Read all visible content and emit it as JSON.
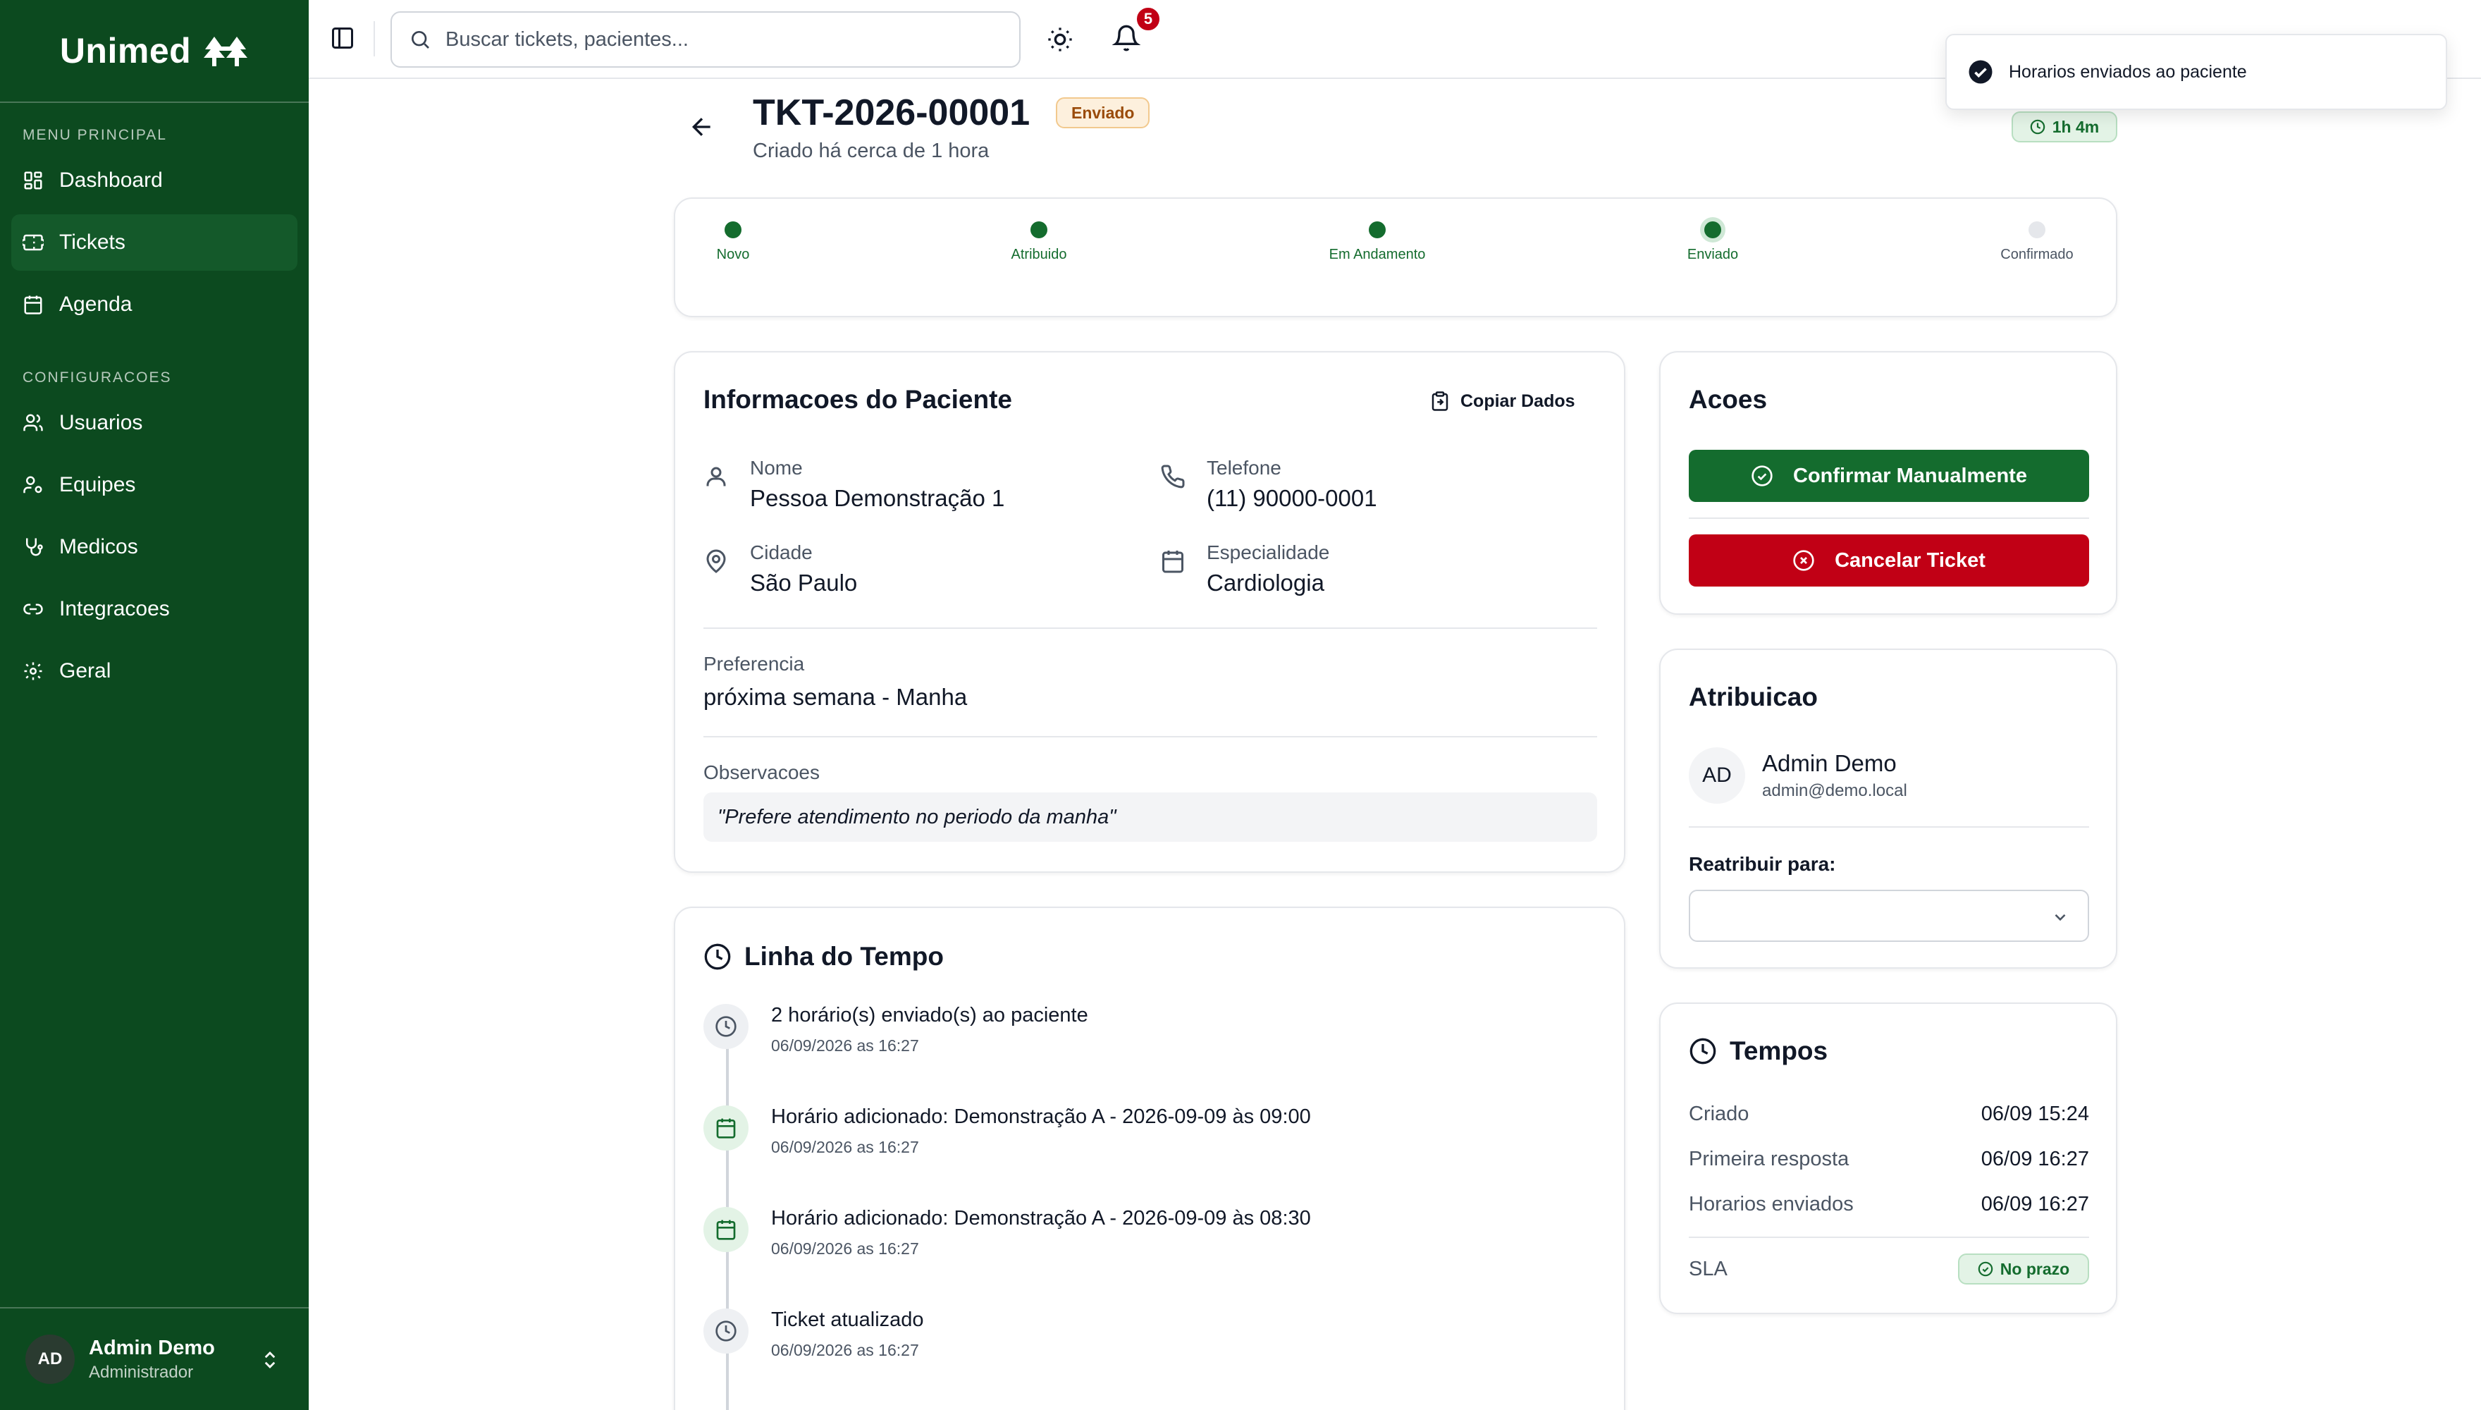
{
  "brand": {
    "name": "Unimed",
    "color": "#0c4a1f",
    "accent": "#146c2e",
    "danger": "#c10015"
  },
  "sidebar": {
    "main_label": "MENU PRINCIPAL",
    "main_items": [
      {
        "label": "Dashboard",
        "icon": "grid-icon"
      },
      {
        "label": "Tickets",
        "icon": "ticket-icon",
        "active": true
      },
      {
        "label": "Agenda",
        "icon": "calendar-icon"
      }
    ],
    "config_label": "CONFIGURACOES",
    "config_items": [
      {
        "label": "Usuarios",
        "icon": "users-icon"
      },
      {
        "label": "Equipes",
        "icon": "user-cog-icon"
      },
      {
        "label": "Medicos",
        "icon": "stethoscope-icon"
      },
      {
        "label": "Integracoes",
        "icon": "link-icon"
      },
      {
        "label": "Geral",
        "icon": "gear-icon"
      }
    ],
    "user": {
      "initials": "AD",
      "name": "Admin Demo",
      "role": "Administrador"
    }
  },
  "topbar": {
    "search_placeholder": "Buscar tickets, pacientes...",
    "notification_count": "5"
  },
  "toast": {
    "message": "Horarios enviados ao paciente"
  },
  "ticket": {
    "id": "TKT-2026-00001",
    "status": "Enviado",
    "created": "Criado há cerca de 1 hora",
    "elapsed": "1h 4m"
  },
  "progress": {
    "steps": [
      {
        "label": "Novo",
        "state": "done"
      },
      {
        "label": "Atribuido",
        "state": "done"
      },
      {
        "label": "Em Andamento",
        "state": "done"
      },
      {
        "label": "Enviado",
        "state": "current"
      },
      {
        "label": "Confirmado",
        "state": "pending"
      }
    ]
  },
  "patient": {
    "title": "Informacoes do Paciente",
    "copy_label": "Copiar Dados",
    "name_label": "Nome",
    "name": "Pessoa Demonstração 1",
    "phone_label": "Telefone",
    "phone": "(11) 90000-0001",
    "city_label": "Cidade",
    "city": "São Paulo",
    "specialty_label": "Especialidade",
    "specialty": "Cardiologia",
    "preference_label": "Preferencia",
    "preference": "próxima semana - Manha",
    "notes_label": "Observacoes",
    "notes": "\"Prefere atendimento no periodo da manha\""
  },
  "timeline": {
    "title": "Linha do Tempo",
    "items": [
      {
        "text": "2 horário(s) enviado(s) ao paciente",
        "date": "06/09/2026 as 16:27",
        "icon": "clock-icon"
      },
      {
        "text": "Horário adicionado: Demonstração A - 2026-09-09 às 09:00",
        "date": "06/09/2026 as 16:27",
        "icon": "calendar-icon"
      },
      {
        "text": "Horário adicionado: Demonstração A - 2026-09-09 às 08:30",
        "date": "06/09/2026 as 16:27",
        "icon": "calendar-icon"
      },
      {
        "text": "Ticket atualizado",
        "date": "06/09/2026 as 16:27",
        "icon": "clock-icon"
      }
    ]
  },
  "actions": {
    "title": "Acoes",
    "confirm": "Confirmar Manualmente",
    "cancel": "Cancelar Ticket"
  },
  "assignment": {
    "title": "Atribuicao",
    "initials": "AD",
    "name": "Admin Demo",
    "email": "admin@demo.local",
    "reassign_label": "Reatribuir para:",
    "reassign_value": ""
  },
  "times": {
    "title": "Tempos",
    "rows": [
      {
        "label": "Criado",
        "value": "06/09 15:24"
      },
      {
        "label": "Primeira resposta",
        "value": "06/09 16:27"
      },
      {
        "label": "Horarios enviados",
        "value": "06/09 16:27"
      }
    ],
    "sla_label": "SLA",
    "sla_status": "No prazo"
  }
}
